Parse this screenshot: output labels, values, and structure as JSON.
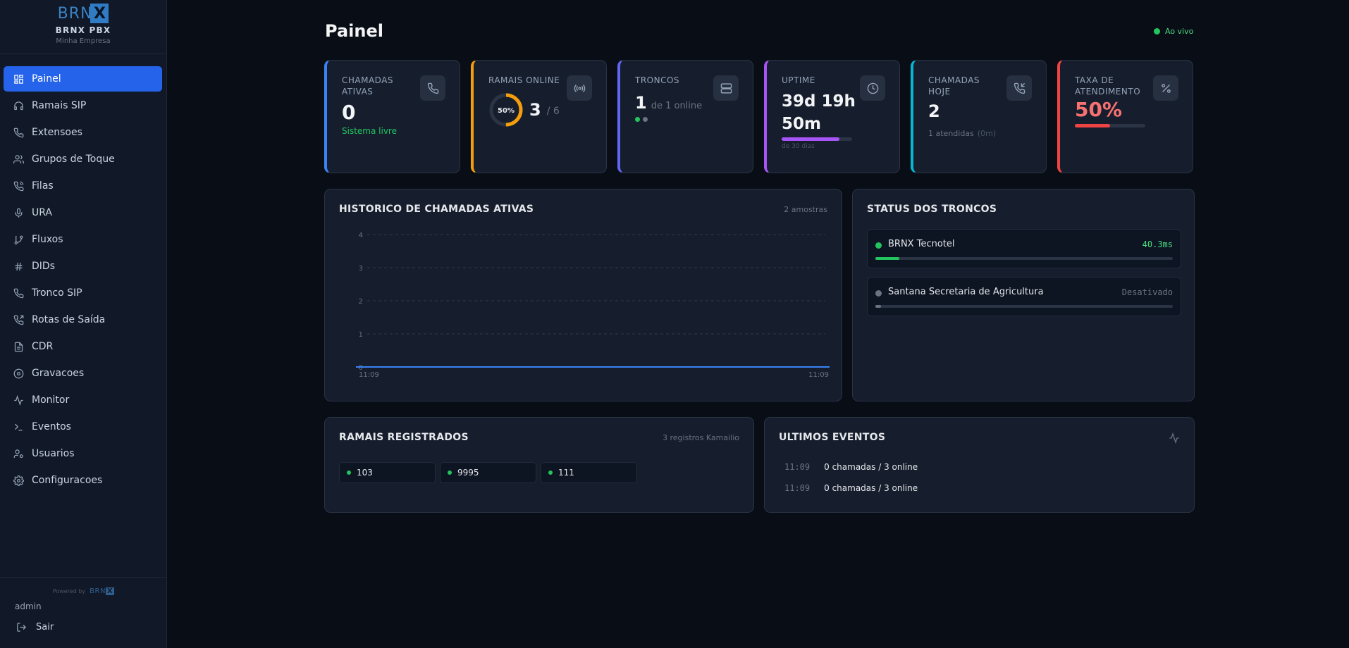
{
  "brand": {
    "logo_text": "BRN",
    "logo_mark": "X",
    "name": "BRNX PBX",
    "company": "Minha Empresa"
  },
  "nav": [
    {
      "label": "Painel",
      "icon": "dashboard-icon",
      "active": true
    },
    {
      "label": "Ramais SIP",
      "icon": "headset-icon"
    },
    {
      "label": "Extensoes",
      "icon": "phone-icon"
    },
    {
      "label": "Grupos de Toque",
      "icon": "users-icon"
    },
    {
      "label": "Filas",
      "icon": "phone-queue-icon"
    },
    {
      "label": "URA",
      "icon": "microphone-icon"
    },
    {
      "label": "Fluxos",
      "icon": "git-branch-icon"
    },
    {
      "label": "DIDs",
      "icon": "hash-icon"
    },
    {
      "label": "Tronco SIP",
      "icon": "phone-icon"
    },
    {
      "label": "Rotas de Saída",
      "icon": "phone-outgoing-icon"
    },
    {
      "label": "CDR",
      "icon": "file-icon"
    },
    {
      "label": "Gravacoes",
      "icon": "record-icon"
    },
    {
      "label": "Monitor",
      "icon": "activity-icon"
    },
    {
      "label": "Eventos",
      "icon": "terminal-icon"
    },
    {
      "label": "Usuarios",
      "icon": "user-cog-icon"
    },
    {
      "label": "Configuracoes",
      "icon": "gear-icon"
    }
  ],
  "footer": {
    "powered_by": "Powered by",
    "powered_logo": "BRN",
    "powered_mark": "X",
    "user": "admin",
    "logout": "Sair"
  },
  "header": {
    "title": "Painel",
    "live": "Ao vivo"
  },
  "stats": {
    "active_calls": {
      "label": "CHAMADAS ATIVAS",
      "value": "0",
      "sub": "Sistema livre",
      "color": "#3b82f6"
    },
    "extensions_online": {
      "label": "RAMAIS ONLINE",
      "pct": "50%",
      "pct_value": 0.5,
      "value": "3",
      "total": "/ 6",
      "color": "#f59e0b"
    },
    "trunks": {
      "label": "TRONCOS",
      "value": "1",
      "sub": "de 1 online",
      "color": "#6366f1"
    },
    "uptime": {
      "label": "UPTIME",
      "value_line1": "39d 19h",
      "value_line2": "50m",
      "sub": "de 30 dias",
      "progress": 1.0,
      "color": "#a855f7"
    },
    "calls_today": {
      "label": "CHAMADAS HOJE",
      "value": "2",
      "sub": "1 atendidas",
      "sub_muted": "(0m)",
      "color": "#06b6d4"
    },
    "answer_rate": {
      "label": "TAXA DE ATENDIMENTO",
      "value": "50%",
      "progress": 0.5,
      "color": "#ef4444"
    }
  },
  "history": {
    "title": "HISTORICO DE CHAMADAS ATIVAS",
    "meta": "2 amostras"
  },
  "chart_data": {
    "type": "line",
    "x": [
      "11:09",
      "11:09"
    ],
    "series": [
      {
        "values": [
          0,
          0
        ]
      }
    ],
    "ylim": [
      0,
      4
    ],
    "yticks": [
      "0",
      "1",
      "2",
      "3",
      "4"
    ],
    "grid": true,
    "color": "#3b82f6"
  },
  "trunk_status": {
    "title": "STATUS DOS TRONCOS",
    "items": [
      {
        "name": "BRNX Tecnotel",
        "status": "40.3ms",
        "online": true,
        "bar": 0.08
      },
      {
        "name": "Santana Secretaria de Agricultura",
        "status": "Desativado",
        "online": false,
        "bar": 0.02
      }
    ]
  },
  "registered": {
    "title": "RAMAIS REGISTRADOS",
    "meta": "3 registros Kamailio",
    "items": [
      "103",
      "9995",
      "111"
    ]
  },
  "events": {
    "title": "ULTIMOS EVENTOS",
    "items": [
      {
        "time": "11:09",
        "text": "0 chamadas / 3 online"
      },
      {
        "time": "11:09",
        "text": "0 chamadas / 3 online"
      }
    ]
  }
}
